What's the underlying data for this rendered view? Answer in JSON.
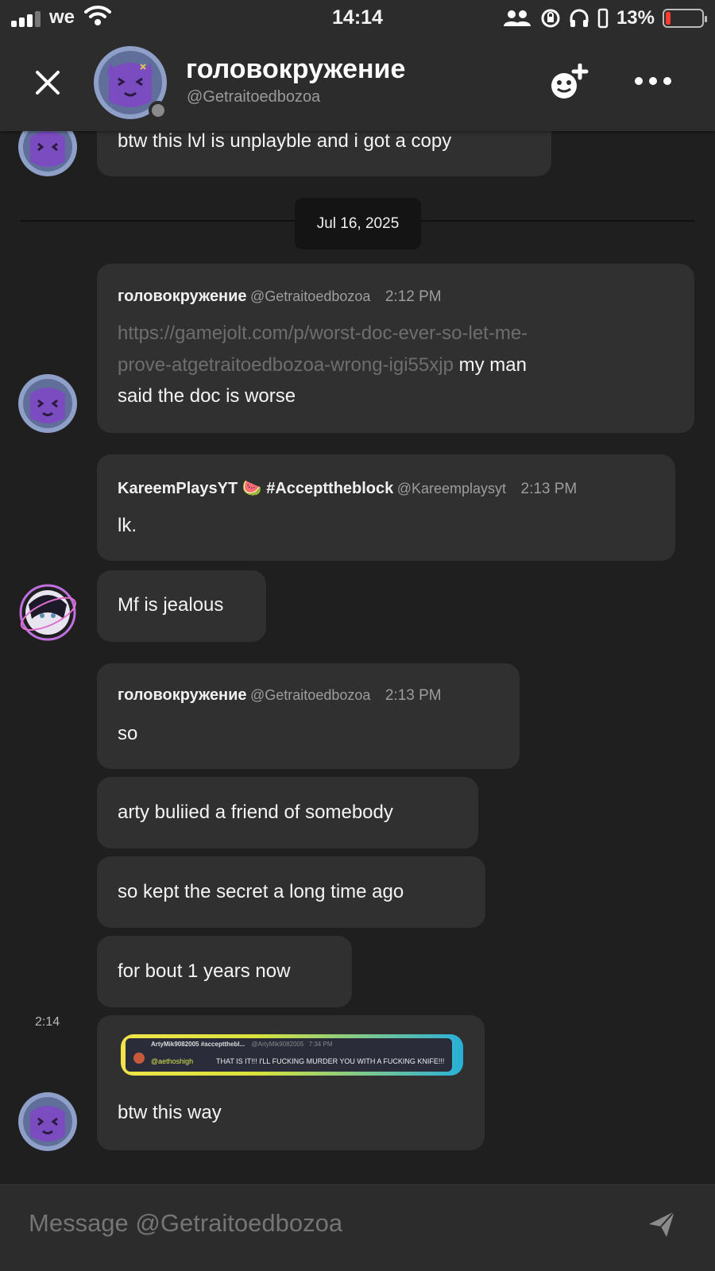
{
  "status_bar": {
    "carrier": "we",
    "time": "14:14",
    "battery_percent": "13%",
    "icons": [
      "signal-icon",
      "wifi-icon",
      "people-icon",
      "orientation-lock-icon",
      "headphones-icon",
      "battery-icon"
    ]
  },
  "header": {
    "name": "головокружение",
    "handle": "@Getraitoedbozoa",
    "icons": [
      "close-icon",
      "add-friend-icon",
      "more-icon"
    ]
  },
  "messages": [
    {
      "text": "btw this lvl is unplayble and i got a copy"
    },
    {
      "date_divider": "Jul 16, 2025"
    },
    {
      "author": "головокружение",
      "handle": "@Getraitoedbozoa",
      "time": "2:12 PM",
      "link_line1": "https://gamejolt.com/p/worst-doc-ever-so-let-me-",
      "link_line2": "prove-atgetraitoedbozoa-wrong-igi55xjp",
      "text_after_link": "my man",
      "text_line3": "said the doc is worse"
    },
    {
      "author": "KareemPlaysYT 🍉 #Accepttheblock",
      "handle": "@Kareemplaysyt",
      "time": "2:13 PM",
      "text": "lk."
    },
    {
      "text": "Mf is jealous"
    },
    {
      "author": "головокружение",
      "handle": "@Getraitoedbozoa",
      "time": "2:13 PM",
      "text": "so"
    },
    {
      "text": "arty buliied a friend of somebody"
    },
    {
      "text": "so kept the secret a long time ago"
    },
    {
      "text": "for bout 1 years now"
    },
    {
      "side_time": "2:14",
      "embed": {
        "user": "ArtyMik9082005 #acceptthebl...",
        "handle": "@ArtyMik9082005",
        "time": "7:34 PM",
        "mention": "@aethoshigh",
        "text": "THAT IS IT!!! I'LL FUCKING MURDER YOU WITH A FUCKING KNIFE!!!"
      },
      "text": "btw this way"
    }
  ],
  "composer": {
    "placeholder": "Message @Getraitoedbozoa"
  },
  "colors": {
    "background": "#1f1f1f",
    "header": "#2c2c2c",
    "bubble": "#303030",
    "avatar_purple": "#6f3fb0",
    "battery_low": "#ff3b30"
  }
}
